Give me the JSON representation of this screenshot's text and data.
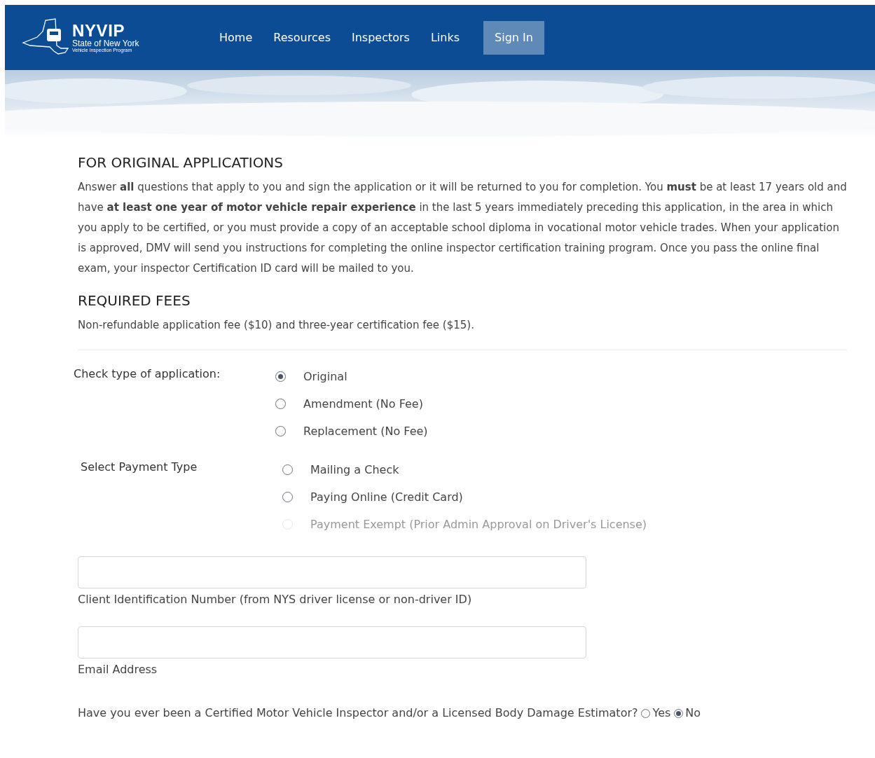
{
  "header": {
    "logo": {
      "title": "NYVIP",
      "subtitle": "State of New York",
      "tagline": "Vehicle Inspection Program"
    },
    "nav": [
      {
        "label": "Home",
        "selected": false
      },
      {
        "label": "Resources",
        "selected": false
      },
      {
        "label": "Inspectors",
        "selected": false
      },
      {
        "label": "Links",
        "selected": false
      },
      {
        "label": "Sign In",
        "selected": true
      }
    ]
  },
  "sections": [
    {
      "heading": "FOR ORIGINAL APPLICATIONS",
      "text": "Answer **all** questions that apply to you and sign the application or it will be returned to you for completion. You **must** be at least 17 years old and have **at least one year of motor vehicle repair experience** in the last 5 years immediately preceding this application, in the area in which you apply to be certified, or you must provide a copy of an acceptable school diploma in vocational motor vehicle trades. When your application is approved, DMV will send you instructions for completing the online inspector certification training program. Once you pass the online final exam, your inspector Certification ID card will be mailed to you."
    },
    {
      "heading": "REQUIRED FEES",
      "text": "Non-refundable application fee ($10) and three-year certification fee ($15)."
    }
  ],
  "radio_groups": [
    {
      "label": "Check type of application:",
      "options": [
        {
          "label": "Original",
          "selected": true,
          "disabled": false
        },
        {
          "label": "Amendment (No Fee)",
          "selected": false,
          "disabled": false
        },
        {
          "label": "Replacement (No Fee)",
          "selected": false,
          "disabled": false
        }
      ]
    },
    {
      "label": "Select Payment Type",
      "options": [
        {
          "label": "Mailing a Check",
          "selected": false,
          "disabled": false
        },
        {
          "label": "Paying Online (Credit Card)",
          "selected": false,
          "disabled": false
        },
        {
          "label": "Payment Exempt (Prior Admin Approval on Driver's License)",
          "selected": false,
          "disabled": true
        }
      ]
    }
  ],
  "fields": [
    {
      "label": "Client Identification Number (from NYS driver license or non-driver ID)"
    },
    {
      "label": "Email Address"
    }
  ],
  "question": {
    "text": "Have you ever been a Certified Motor Vehicle Inspector and/or a Licensed Body Damage Estimator?",
    "options": [
      {
        "label": "Yes",
        "selected": false
      },
      {
        "label": "No",
        "selected": true
      }
    ]
  }
}
